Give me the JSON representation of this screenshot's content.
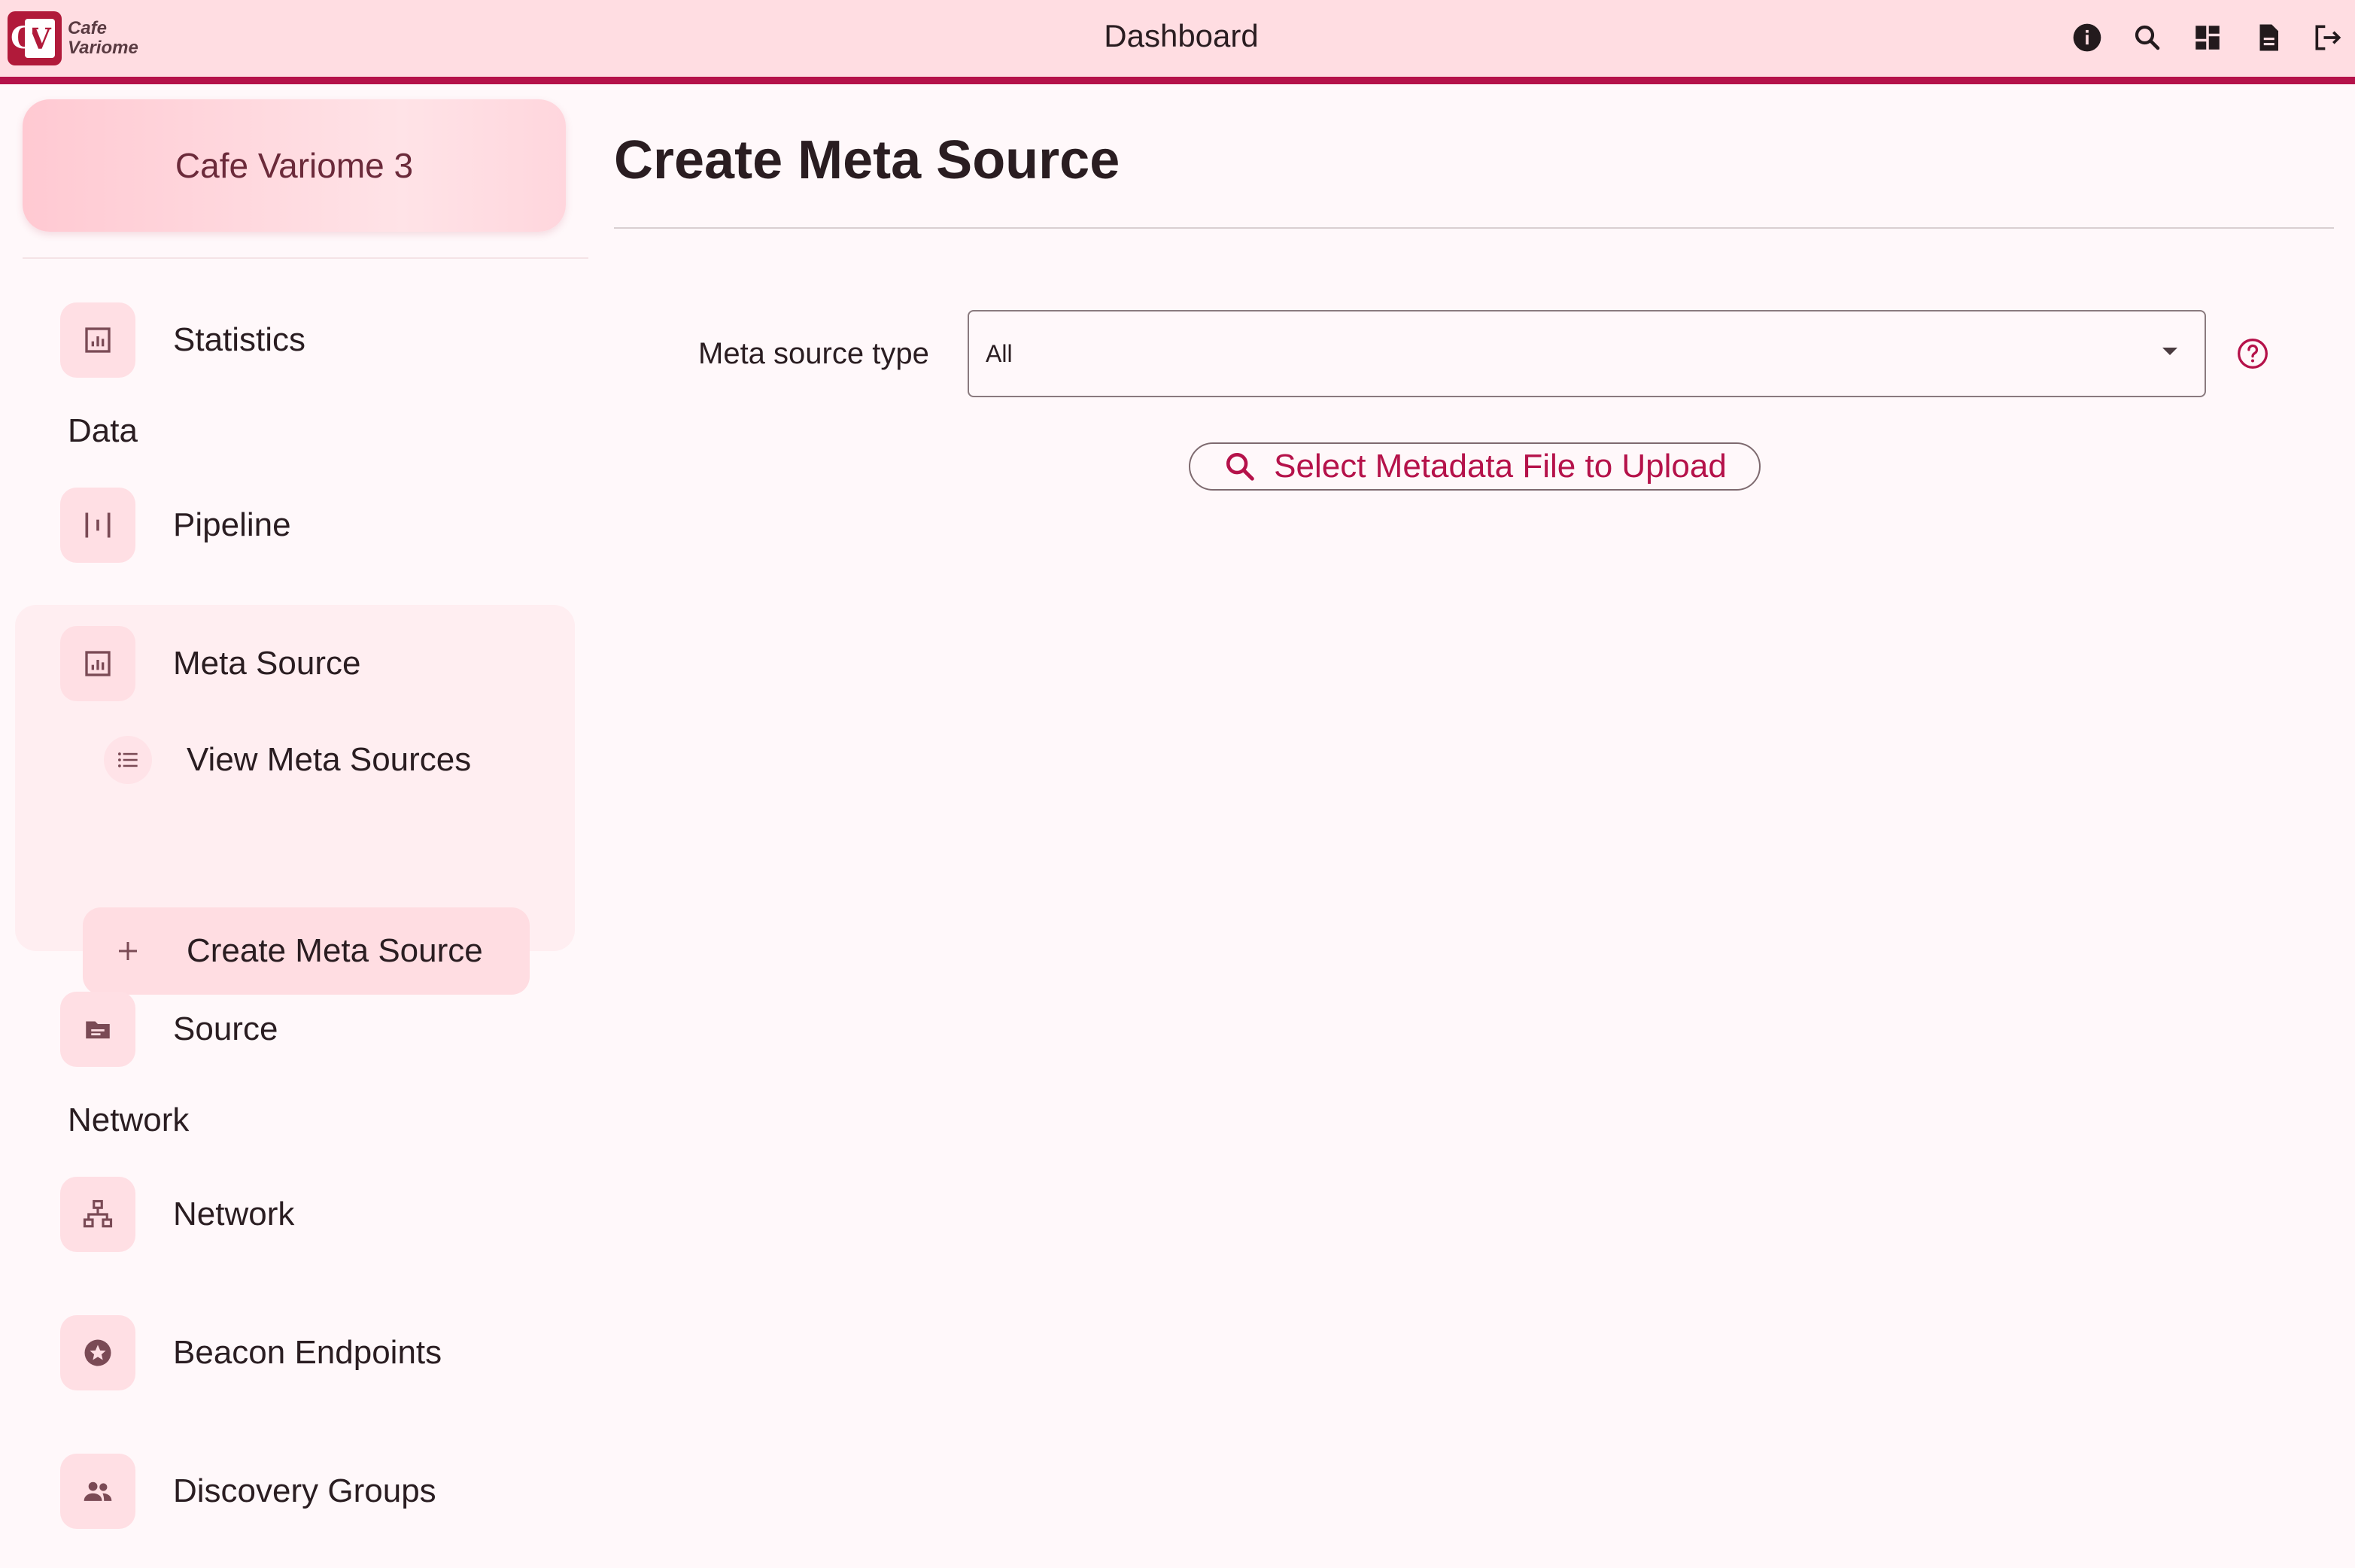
{
  "app": {
    "logo_text_line1": "Cafe",
    "logo_text_line2": "Variome",
    "logo_letters": "CV",
    "title": "Dashboard"
  },
  "toolbar_icons": [
    {
      "name": "info-icon"
    },
    {
      "name": "search-icon"
    },
    {
      "name": "dashboard-icon"
    },
    {
      "name": "document-icon"
    },
    {
      "name": "logout-icon"
    }
  ],
  "sidebar": {
    "brand": "Cafe Variome 3",
    "items": {
      "statistics": {
        "label": "Statistics",
        "icon": "statistics-icon"
      },
      "pipeline": {
        "label": "Pipeline",
        "icon": "pipeline-icon"
      },
      "meta_source": {
        "label": "Meta Source",
        "icon": "meta-source-icon"
      },
      "view_meta_sources": {
        "label": "View Meta Sources",
        "icon": "list-icon"
      },
      "create_meta_source": {
        "label": "Create Meta Source",
        "icon": "plus-icon"
      },
      "source": {
        "label": "Source",
        "icon": "folder-icon"
      },
      "network": {
        "label": "Network",
        "icon": "network-icon"
      },
      "beacon_endpoints": {
        "label": "Beacon Endpoints",
        "icon": "star-badge-icon"
      },
      "discovery_groups": {
        "label": "Discovery Groups",
        "icon": "group-icon"
      }
    },
    "sections": {
      "data": "Data",
      "network": "Network"
    }
  },
  "main": {
    "title": "Create Meta Source",
    "form": {
      "meta_source_type_label": "Meta source type",
      "meta_source_type_value": "All",
      "upload_button_label": "Select Metadata File to Upload"
    }
  },
  "colors": {
    "accent": "#b5124a",
    "topbar_bg": "#ffdde2",
    "nav_icon_bg": "#ffdfe4",
    "page_bg": "#fff8fa"
  }
}
